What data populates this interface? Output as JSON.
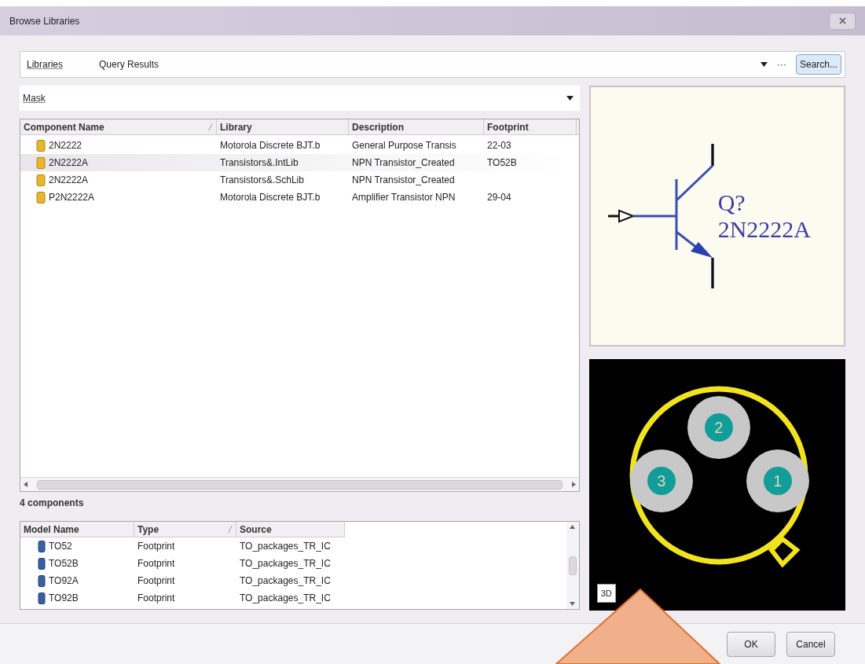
{
  "window": {
    "title": "Browse Libraries"
  },
  "libraries": {
    "label": "Libraries",
    "value": "Query Results",
    "browse_button": "···",
    "search_button": "Search..."
  },
  "mask": {
    "label": "Mask"
  },
  "components_table": {
    "columns": [
      {
        "label": "Component Name",
        "sorted": true
      },
      {
        "label": "Library",
        "sorted": false
      },
      {
        "label": "Description",
        "sorted": false
      },
      {
        "label": "Footprint",
        "sorted": false
      }
    ],
    "rows": [
      {
        "name": "2N2222",
        "library": "Motorola Discrete BJT.b",
        "description": "General Purpose Transis",
        "footprint": "22-03",
        "selected": false
      },
      {
        "name": "2N2222A",
        "library": "Transistors&.IntLib",
        "description": "NPN Transistor_Created",
        "footprint": "TO52B",
        "selected": true
      },
      {
        "name": "2N2222A",
        "library": "Transistors&.SchLib",
        "description": "NPN Transistor_Created",
        "selected": false
      },
      {
        "name": "P2N2222A",
        "library": "Motorola Discrete BJT.b",
        "description": "Amplifier Transistor NPN",
        "footprint": "29-04",
        "selected": false
      }
    ]
  },
  "status": "4 components",
  "models_table": {
    "columns": [
      {
        "label": "Model Name",
        "sorted": false
      },
      {
        "label": "Type",
        "sorted": true
      },
      {
        "label": "Source",
        "sorted": false
      }
    ],
    "rows": [
      {
        "name": "TO52",
        "type": "Footprint",
        "source": "TO_packages_TR_IC"
      },
      {
        "name": "TO52B",
        "type": "Footprint",
        "source": "TO_packages_TR_IC"
      },
      {
        "name": "TO92A",
        "type": "Footprint",
        "source": "TO_packages_TR_IC"
      },
      {
        "name": "TO92B",
        "type": "Footprint",
        "source": "TO_packages_TR_IC"
      }
    ]
  },
  "schematic_preview": {
    "designator": "Q?",
    "comment": "2N2222A"
  },
  "footprint_preview": {
    "pads": [
      "2",
      "3",
      "1"
    ],
    "view_button": "3D"
  },
  "buttons": [
    "OK",
    "Cancel"
  ]
}
